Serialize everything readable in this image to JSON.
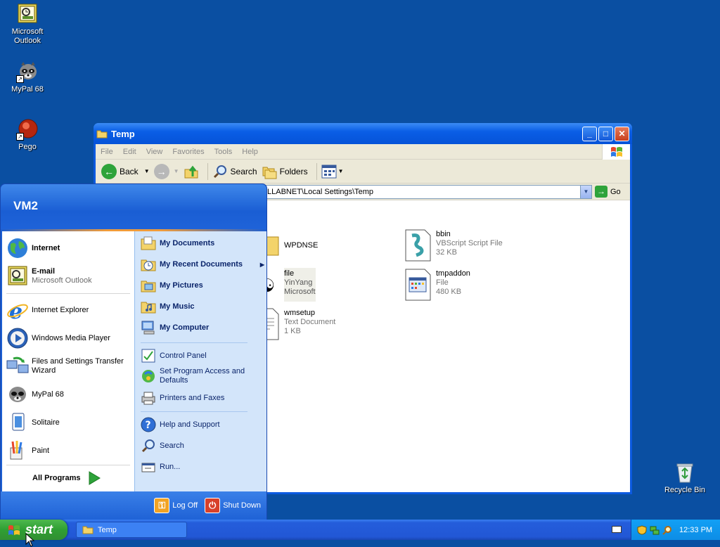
{
  "desktop": {
    "icons": [
      {
        "label": "Microsoft Outlook"
      },
      {
        "label": "MyPal 68"
      },
      {
        "label": "Pego"
      },
      {
        "label": "Recycle Bin"
      }
    ]
  },
  "explorer": {
    "title": "Temp",
    "menu": [
      "File",
      "Edit",
      "View",
      "Favorites",
      "Tools",
      "Help"
    ],
    "toolbar": {
      "back": "Back",
      "search": "Search",
      "folders": "Folders"
    },
    "address": "LLABNET\\Local Settings\\Temp",
    "go": "Go",
    "files": [
      {
        "name": "WPDNSE",
        "type": "",
        "size": ""
      },
      {
        "name": "bbin",
        "type": "VBScript Script File",
        "size": "32 KB"
      },
      {
        "name": "file",
        "type": "YinYang",
        "size": "Microsoft"
      },
      {
        "name": "tmpaddon",
        "type": "File",
        "size": "480 KB"
      },
      {
        "name": "wmsetup",
        "type": "Text Document",
        "size": "1 KB"
      }
    ]
  },
  "start_menu": {
    "user": "VM2",
    "pinned": [
      {
        "title": "Internet",
        "subtitle": ""
      },
      {
        "title": "E-mail",
        "subtitle": "Microsoft Outlook"
      }
    ],
    "recent": [
      {
        "title": "Internet Explorer"
      },
      {
        "title": "Windows Media Player"
      },
      {
        "title": "Files and Settings Transfer Wizard"
      },
      {
        "title": "MyPal 68"
      },
      {
        "title": "Solitaire"
      },
      {
        "title": "Paint"
      }
    ],
    "all_programs": "All Programs",
    "places": [
      {
        "title": "My Documents"
      },
      {
        "title": "My Recent Documents"
      },
      {
        "title": "My Pictures"
      },
      {
        "title": "My Music"
      },
      {
        "title": "My Computer"
      }
    ],
    "system": [
      {
        "title": "Control Panel"
      },
      {
        "title": "Set Program Access and Defaults"
      },
      {
        "title": "Printers and Faxes"
      }
    ],
    "help": [
      {
        "title": "Help and Support"
      },
      {
        "title": "Search"
      },
      {
        "title": "Run..."
      }
    ],
    "log_off": "Log Off",
    "shut_down": "Shut Down"
  },
  "taskbar": {
    "start": "start",
    "task": "Temp",
    "clock": "12:33 PM"
  }
}
